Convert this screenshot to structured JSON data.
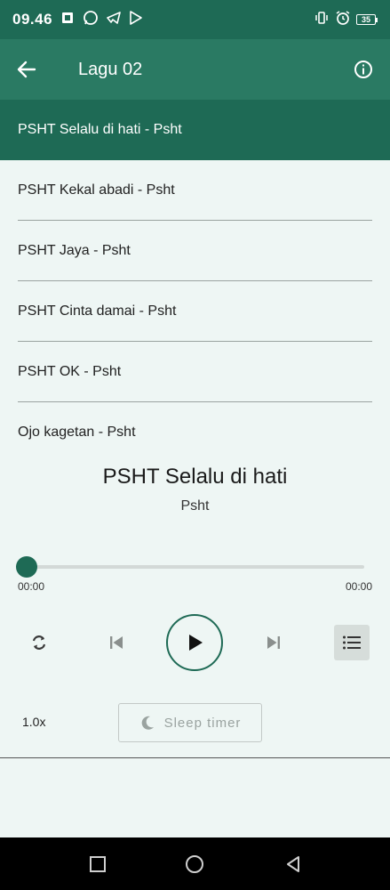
{
  "status_bar": {
    "time": "09.46",
    "battery": "35"
  },
  "app_bar": {
    "title": "Lagu 02"
  },
  "playlist": [
    {
      "label": "PSHT Selalu di hati - Psht",
      "active": true
    },
    {
      "label": "PSHT Kekal abadi - Psht",
      "active": false
    },
    {
      "label": "PSHT Jaya - Psht",
      "active": false
    },
    {
      "label": "PSHT Cinta damai - Psht",
      "active": false
    },
    {
      "label": "PSHT OK - Psht",
      "active": false
    },
    {
      "label": "Ojo kagetan - Psht",
      "active": false
    }
  ],
  "now_playing": {
    "title": "PSHT Selalu di hati",
    "artist": "Psht"
  },
  "progress": {
    "elapsed": "00:00",
    "duration": "00:00",
    "fraction": 0
  },
  "controls": {
    "speed": "1.0x",
    "sleep_timer_label": "Sleep timer"
  },
  "icons": {
    "status_left": [
      "gallery-icon",
      "whatsapp-icon",
      "telegram-icon",
      "play-store-icon"
    ],
    "status_right": [
      "vibrate-icon",
      "alarm-icon",
      "battery-icon"
    ],
    "controls": [
      "repeat-icon",
      "skip-previous-icon",
      "play-icon",
      "skip-next-icon",
      "playlist-icon",
      "moon-icon"
    ],
    "nav": [
      "recents-icon",
      "home-icon",
      "back-icon"
    ]
  },
  "colors": {
    "primary_dark": "#1e6a55",
    "primary": "#2a7a63",
    "background": "#eef6f4"
  }
}
